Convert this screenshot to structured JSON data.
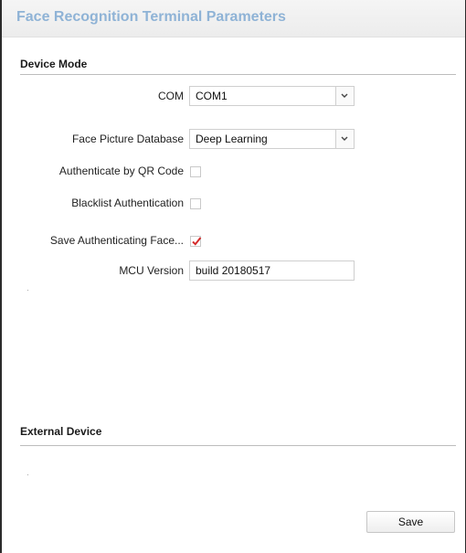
{
  "title": "Face Recognition Terminal Parameters",
  "sections": {
    "device_mode": "Device Mode",
    "external_device": "External Device"
  },
  "fields": {
    "com": {
      "label": "COM",
      "value": "COM1"
    },
    "face_picture_database": {
      "label": "Face Picture Database",
      "value": "Deep Learning"
    },
    "authenticate_by_qr_code": {
      "label": "Authenticate by QR Code",
      "checked": false
    },
    "blacklist_authentication": {
      "label": "Blacklist Authentication",
      "checked": false
    },
    "save_authenticating_face": {
      "label": "Save Authenticating Face...",
      "checked": true
    },
    "mcu_version": {
      "label": "MCU Version",
      "value": "build 20180517"
    }
  },
  "buttons": {
    "save": "Save"
  },
  "colors": {
    "title": "#8fb3d6",
    "checkmark": "#d42a2a"
  }
}
